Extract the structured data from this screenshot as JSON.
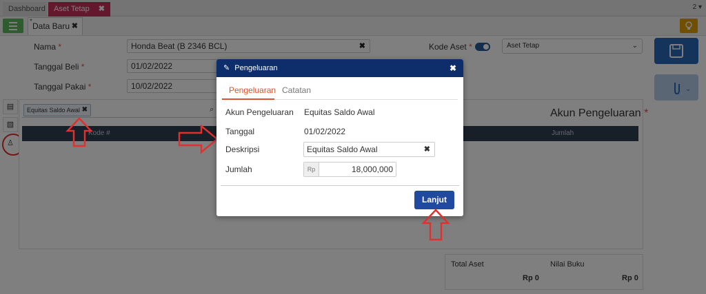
{
  "tabs": {
    "dashboard": "Dashboard",
    "aset_tetap": "Aset Tetap",
    "count": "2"
  },
  "doc_tab": {
    "label": "Data Baru"
  },
  "form": {
    "nama_label": "Nama",
    "nama_value": "Honda Beat (B 2346 BCL)",
    "tanggal_beli_label": "Tanggal Beli",
    "tanggal_beli_value": "01/02/2022",
    "tanggal_pakai_label": "Tanggal Pakai",
    "tanggal_pakai_value": "10/02/2022",
    "kode_aset_label": "Kode Aset",
    "kode_aset_select": "Aset Tetap"
  },
  "panel": {
    "tag": "Equitas Saldo Awal",
    "title": "Akun Pengeluaran",
    "col_kode": "Kode #",
    "col_jumlah": "Jumlah"
  },
  "totals": {
    "total_aset_label": "Total Aset",
    "total_aset_value": "Rp 0",
    "nilai_buku_label": "Nilai Buku",
    "nilai_buku_value": "Rp 0"
  },
  "modal": {
    "title": "Pengeluaran",
    "tab_active": "Pengeluaran",
    "tab_other": "Catatan",
    "akun_label": "Akun Pengeluaran",
    "akun_value": "Equitas Saldo Awal",
    "tanggal_label": "Tanggal",
    "tanggal_value": "01/02/2022",
    "deskripsi_label": "Deskripsi",
    "deskripsi_value": "Equitas Saldo Awal",
    "jumlah_label": "Jumlah",
    "currency": "Rp",
    "jumlah_value": "18,000,000",
    "submit_label": "Lanjut"
  },
  "colors": {
    "accent": "#0d2d6b",
    "annotation": "#e03030"
  }
}
